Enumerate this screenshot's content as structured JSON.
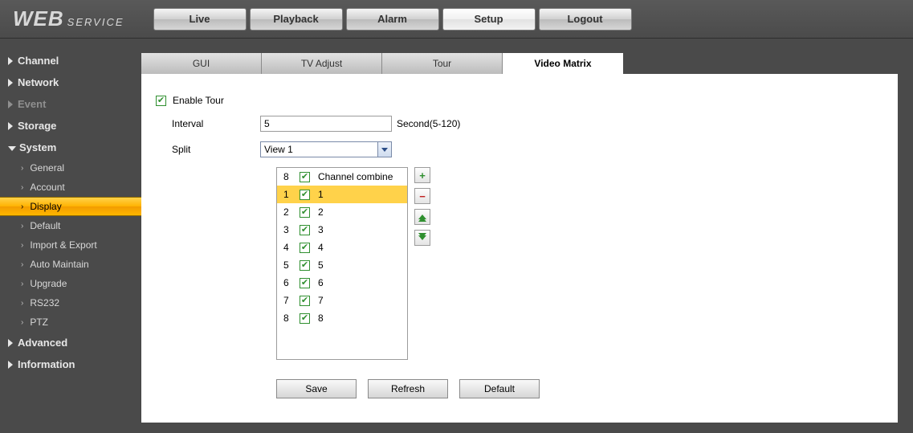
{
  "logo": {
    "big": "WEB",
    "small": "SERVICE"
  },
  "top_tabs": {
    "live": "Live",
    "playback": "Playback",
    "alarm": "Alarm",
    "setup": "Setup",
    "logout": "Logout",
    "active": "Setup"
  },
  "sidebar": {
    "channel": "Channel",
    "network": "Network",
    "event": "Event",
    "storage": "Storage",
    "system": "System",
    "system_items": {
      "general": "General",
      "account": "Account",
      "display": "Display",
      "default": "Default",
      "import_export": "Import & Export",
      "auto_maintain": "Auto Maintain",
      "upgrade": "Upgrade",
      "rs232": "RS232",
      "ptz": "PTZ"
    },
    "advanced": "Advanced",
    "information": "Information"
  },
  "sub_tabs": {
    "gui": "GUI",
    "tv_adjust": "TV Adjust",
    "tour": "Tour",
    "video_matrix": "Video Matrix",
    "active": "Video Matrix"
  },
  "form": {
    "enable_tour_label": "Enable Tour",
    "enable_tour_checked": true,
    "interval_label": "Interval",
    "interval_value": "5",
    "interval_hint": "Second(5-120)",
    "split_label": "Split",
    "split_value": "View 1",
    "channel_list": {
      "header_num": "8",
      "header_label": "Channel combine",
      "header_checked": true,
      "rows": [
        {
          "num": "1",
          "label": "1",
          "checked": true,
          "selected": true
        },
        {
          "num": "2",
          "label": "2",
          "checked": true,
          "selected": false
        },
        {
          "num": "3",
          "label": "3",
          "checked": true,
          "selected": false
        },
        {
          "num": "4",
          "label": "4",
          "checked": true,
          "selected": false
        },
        {
          "num": "5",
          "label": "5",
          "checked": true,
          "selected": false
        },
        {
          "num": "6",
          "label": "6",
          "checked": true,
          "selected": false
        },
        {
          "num": "7",
          "label": "7",
          "checked": true,
          "selected": false
        },
        {
          "num": "8",
          "label": "8",
          "checked": true,
          "selected": false
        }
      ]
    },
    "buttons": {
      "save": "Save",
      "refresh": "Refresh",
      "default": "Default"
    }
  }
}
